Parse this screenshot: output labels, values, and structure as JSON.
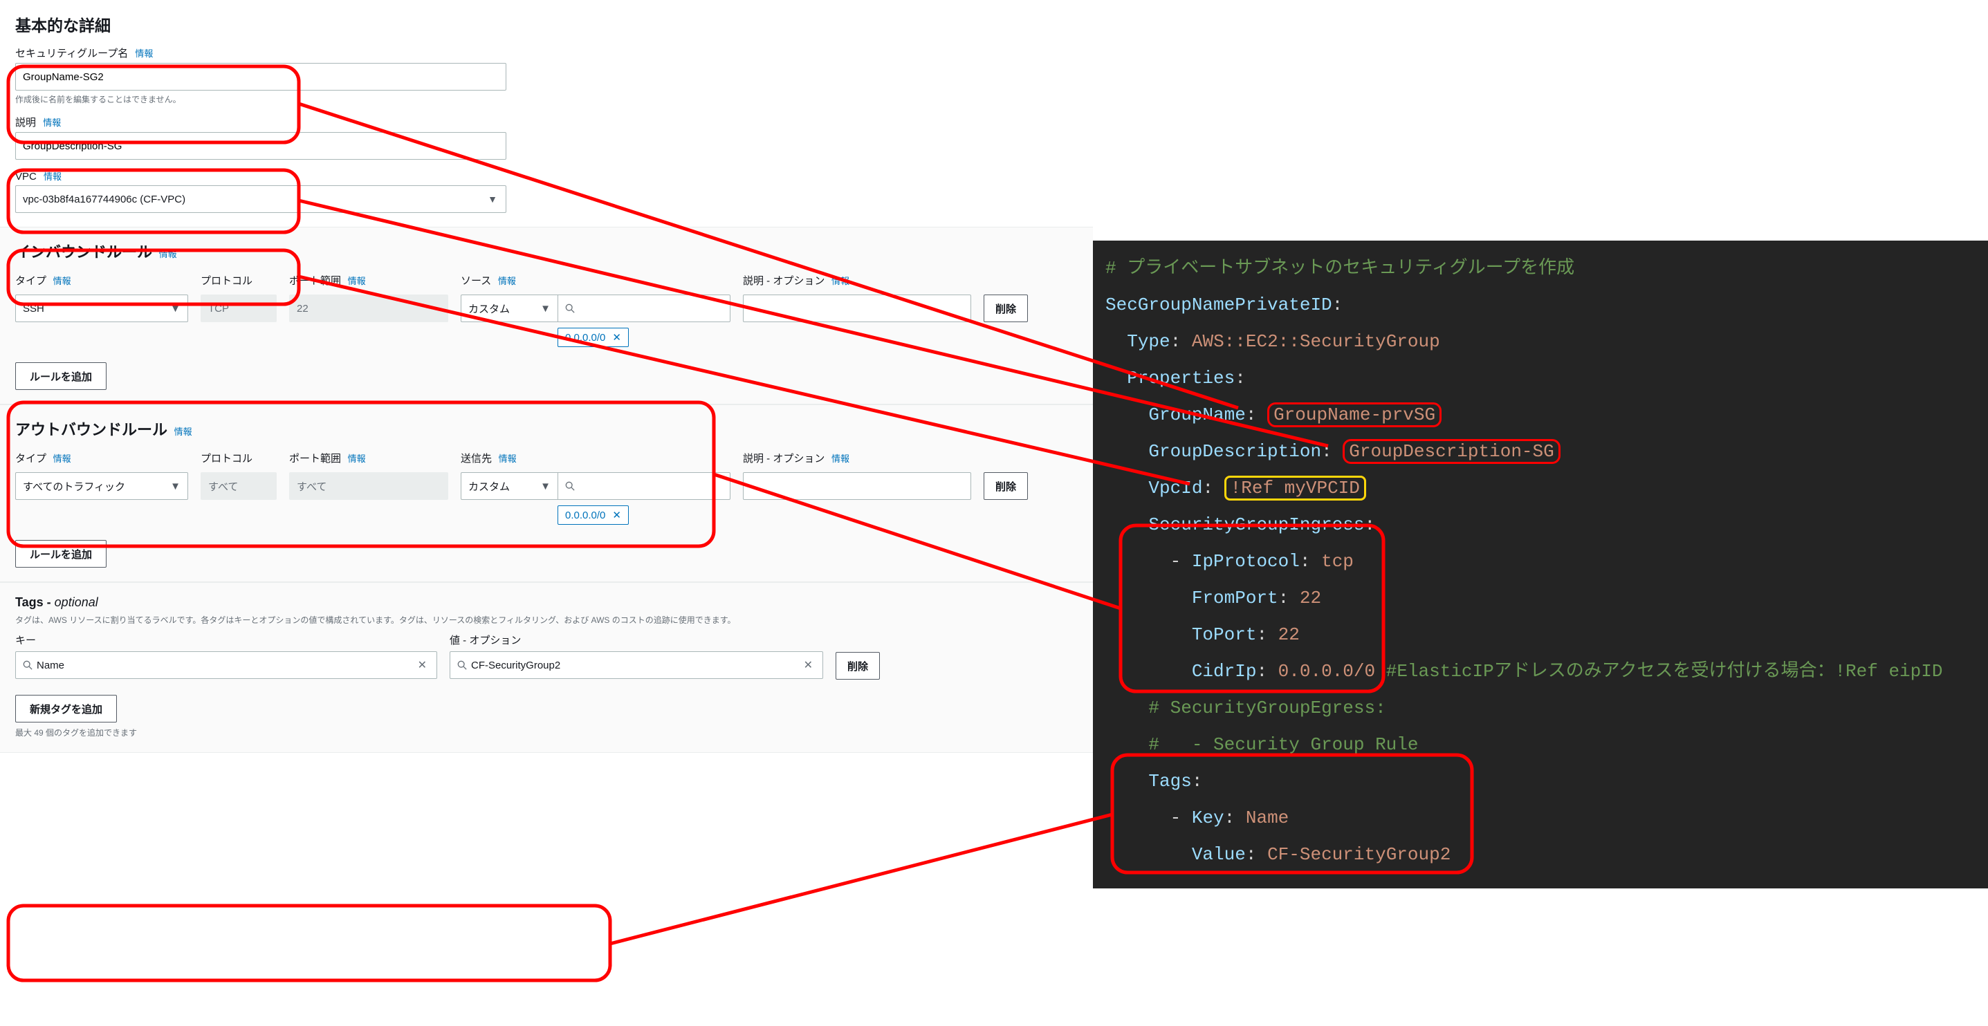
{
  "labels": {
    "info": "情報"
  },
  "basic": {
    "title": "基本的な詳細",
    "sg_name_label": "セキュリティグループ名",
    "sg_name_value": "GroupName-SG2",
    "sg_name_note": "作成後に名前を編集することはできません。",
    "desc_label": "説明",
    "desc_value": "GroupDescription-SG",
    "vpc_label": "VPC",
    "vpc_value": "vpc-03b8f4a167744906c (CF-VPC)"
  },
  "inbound": {
    "title": "インバウンドルール",
    "cols": {
      "type": "タイプ",
      "protocol": "プロトコル",
      "port": "ポート範囲",
      "source": "ソース",
      "desc": "説明 - オプション"
    },
    "row": {
      "type": "SSH",
      "protocol": "TCP",
      "port": "22",
      "source_mode": "カスタム",
      "cidr_tag": "0.0.0.0/0"
    },
    "delete": "削除",
    "add_rule": "ルールを追加"
  },
  "outbound": {
    "title": "アウトバウンドルール",
    "cols": {
      "type": "タイプ",
      "protocol": "プロトコル",
      "port": "ポート範囲",
      "dest": "送信先",
      "desc": "説明 - オプション"
    },
    "row": {
      "type": "すべてのトラフィック",
      "protocol": "すべて",
      "port": "すべて",
      "dest_mode": "カスタム",
      "cidr_tag": "0.0.0.0/0"
    },
    "delete": "削除",
    "add_rule": "ルールを追加"
  },
  "tags": {
    "title_prefix": "Tags - ",
    "title_optional": "optional",
    "desc": "タグは、AWS リソースに割り当てるラベルです。各タグはキーとオプションの値で構成されています。タグは、リソースの検索とフィルタリング、および AWS のコストの追跡に使用できます。",
    "key_label": "キー",
    "val_label": "値 - オプション",
    "row": {
      "key": "Name",
      "value": "CF-SecurityGroup2"
    },
    "delete": "削除",
    "add_new": "新規タグを追加",
    "limit": "最大 49 個のタグを追加できます"
  },
  "code": {
    "comment_top": "# プライベートサブネットのセキュリティグループを作成",
    "id": "SecGroupNamePrivateID",
    "type_key": "Type",
    "type_val": "AWS::EC2::SecurityGroup",
    "props": "Properties",
    "group_name_key": "GroupName",
    "group_name_val": "GroupName-prvSG",
    "group_desc_key": "GroupDescription",
    "group_desc_val": "GroupDescription-SG",
    "vpcid_key": "VpcId",
    "vpcid_val": "!Ref myVPCID",
    "sgi": "SecurityGroupIngress",
    "ipprotocol_key": "IpProtocol",
    "ipprotocol_val": "tcp",
    "fromport_key": "FromPort",
    "fromport_val": "22",
    "toport_key": "ToPort",
    "toport_val": "22",
    "cidrip_key": "CidrIp",
    "cidrip_val": "0.0.0.0/0",
    "cidrip_comment": "#ElasticIPアドレスのみアクセスを受け付ける場合：!Ref eipID",
    "sge_comment1": "# SecurityGroupEgress:",
    "sge_comment2": "#   - Security Group Rule",
    "tags_key": "Tags",
    "tag_key_key": "Key",
    "tag_key_val": "Name",
    "tag_val_key": "Value",
    "tag_val_val": "CF-SecurityGroup2"
  }
}
